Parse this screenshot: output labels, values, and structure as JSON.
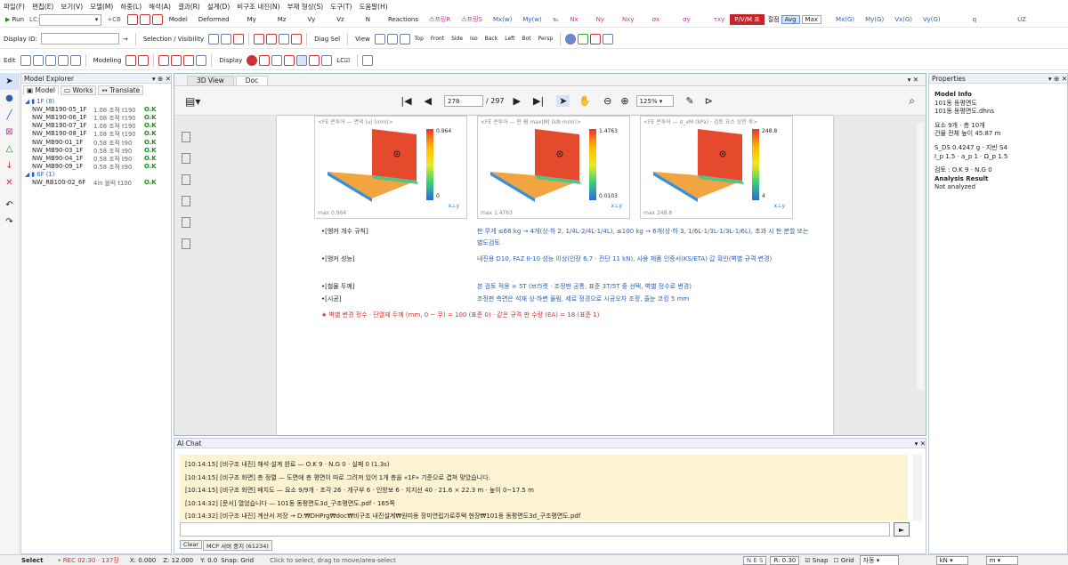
{
  "menu": [
    "파일(F)",
    "편집(E)",
    "보기(V)",
    "모델(M)",
    "하중(L)",
    "해석(A)",
    "결과(R)",
    "설계(D)",
    "비구조 내진(N)",
    "부재 형상(S)",
    "도구(T)",
    "도움말(H)"
  ],
  "toolbar1": {
    "run": "Run",
    "lc_label": "LC:",
    "cb": "+CB",
    "items": [
      "Model",
      "Deformed",
      "My",
      "Mz",
      "Vy",
      "Vz",
      "N",
      "Reactions"
    ],
    "spring_r": "스프링R",
    "spring_s": "스프링S",
    "more": [
      "Mx(w)",
      "My(w)"
    ],
    "nx": "Nx",
    "ny": "Ny",
    "nxy": "Nxy",
    "sx": "σx",
    "sy": "σy",
    "txy": "τxy",
    "pvm": "P/V/M 표",
    "jeol": "절점",
    "avg": "Avg",
    "max": "Max",
    "right": [
      "Mx(G)",
      "My(G)",
      "Vx(G)",
      "Vy(G)"
    ],
    "q": "q",
    "uz": "UZ"
  },
  "toolbar2": {
    "display_id": "Display ID:",
    "arrow": "→",
    "sel_vis": "Selection / Visibility",
    "diag_sel": "Diag Sel",
    "view": "View",
    "views": [
      "Top",
      "Front",
      "Side",
      "Iso",
      "Back",
      "Left",
      "Bot",
      "Persp"
    ]
  },
  "toolbar3": {
    "edit": "Edit",
    "modeling": "Modeling",
    "display": "Display",
    "lc_check": "LC☑"
  },
  "explorer": {
    "title": "Model Explorer",
    "tabs": [
      "Model",
      "Works",
      "Translate"
    ],
    "groups": [
      {
        "label": "1F (8)",
        "rows": [
          [
            "NW_MB190-05_1F",
            "1.08 조적 t190",
            "O.K"
          ],
          [
            "NW_MB190-06_1F",
            "1.08 조적 t190",
            "O.K"
          ],
          [
            "NW_MB190-07_1F",
            "1.08 조적 t190",
            "O.K"
          ],
          [
            "NW_MB190-08_1F",
            "1.08 조적 t190",
            "O.K"
          ],
          [
            "NW_MB90-01_1F",
            "0.58 조적 t90",
            "O.K"
          ],
          [
            "NW_MB90-03_1F",
            "0.58 조적 t90",
            "O.K"
          ],
          [
            "NW_MB90-04_1F",
            "0.58 조적 t90",
            "O.K"
          ],
          [
            "NW_MB90-09_1F",
            "0.58 조적 t90",
            "O.K"
          ]
        ]
      },
      {
        "label": "6F (1)",
        "rows": [
          [
            "NW_RB100-02_6F",
            "4in 블럭 t100",
            "O.K"
          ]
        ]
      }
    ]
  },
  "doc": {
    "tabs": [
      "3D View",
      "Doc"
    ],
    "page": "278",
    "total": "/ 297",
    "zoom": "125%",
    "plots": [
      {
        "title": "<FE 콘투어 — 면외 |u| (mm)>",
        "max": "0.964",
        "min": "0",
        "foot": "max 0.964"
      },
      {
        "title": "<FE 콘투어 — 판 휨 max|M| (kN·m/m)>",
        "max": "1.4763",
        "min": "0.0103",
        "foot": "max 1.4763"
      },
      {
        "title": "<FE 콘투어 — σ_vM (kPa) · 검토 요소 상한 후>",
        "max": "248.8",
        "min": "4",
        "foot": "max 248.8"
      }
    ],
    "lines": [
      {
        "k": "•[앵커 개수 규칙]",
        "v": "판 무게 ≤68 kg → 4개(상·하 2, 1/4L-2/4L-1/4L), ≤100 kg → 6개(상·하 3, 1/6L-1/3L-1/3L-1/6L), 초과 시 판 분할 또는 별도검토"
      },
      {
        "k": "•[앵커 성능]",
        "v": "내진용 D10, FAZ II-10 성능 이상(인장 6.7 · 전단 11 kN), 사용 제품 인증서(KS/ETA) 값 확인(벽별 규격 변경)"
      },
      {
        "k": "•[철물 두께]",
        "v": "본 검토 적용 = 5T (브라켓 · 조정판 공통, 표준 3T/5T 중 선택, 벽별 정수로 변경)"
      },
      {
        "k": "•[시공]",
        "v": "조정판 측면은 석재 상·하변 물림, 세로 정경으로 시공오차 조정, 줄눈 코킹 5 mm"
      }
    ],
    "note": "★ 벽별 변경 정수 · 단열재 두께 (mm, 0 ~ 무) = 100 (표준 0) · 같은 규격 판 수량 (EA) = 18 (표준 1)"
  },
  "chat": {
    "title": "AI Chat",
    "lines": [
      "[10:14:15] [비구조 내진] 해석·설계 완료 — O.K 9 · N.G 0 · 실패 0 (1.3s)",
      "[10:14:15] [비구조 화면] 층 정렬 — 도면에 층 평면이 따로 그려져 있어 1개 층을 «1F» 기준으로 겹쳐 맞았습니다.",
      "[10:14:15] [비구조 화면] 배치도 — 요소 9/9개 · 조각 26 · 개구부 6 · 인방보 6 · 지지선 40 · 21.6 × 22.3 m · 높이 0~17.5 m",
      "[10:14:32] [문서] 열었습니다 — 101동 동평면도3d_구조평면도.pdf · 165쪽",
      "[10:14:32] [비구조 내진] 계산서 저장 → D:₩DHPrg₩doc₩비구조 내진설계₩원미동 장미연립가로주택 현장₩101동 동평면도3d_구조평면도.pdf"
    ],
    "clear": "Clear",
    "mcp": "MCP 서버 중지 (61234)",
    "send": "►"
  },
  "props": {
    "title": "Properties",
    "lines": [
      "Model Info",
      "101동 동평면도",
      "101동 동평면도.dhns",
      "",
      "요소 9개 · 층 10개",
      "건물 전체 높이 45.87 m",
      "",
      "S_DS 0.4247 g · 지반 S4",
      "I_p 1.5 · a_p 1 · Ω_p 1.5",
      "",
      "검토 : O.K 9 · N.G 0",
      "Analysis Result",
      "Not analyzed"
    ]
  },
  "status": {
    "mode": "Select",
    "rec": "• REC 02:30 · 137장",
    "x": "X: 0.000",
    "z": "Z: 12.000",
    "y": "Y: 0.0",
    "snap": "Snap: Grid",
    "hint": "Click to select, drag to move/area-select",
    "nes": "N E S",
    "r": "R: 0.30",
    "snapchk": "Snap",
    "grid": "Grid",
    "auto": "자동",
    "unit1": "kN",
    "unit2": "m"
  },
  "colors": {
    "accent": "#c1272d",
    "blue": "#2a5fb8",
    "ok": "#1a8a1a"
  }
}
